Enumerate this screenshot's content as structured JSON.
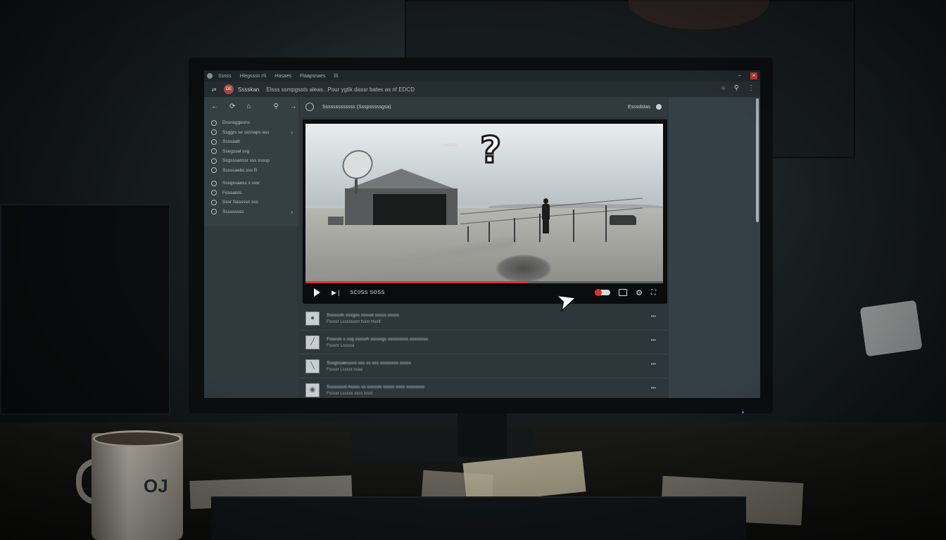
{
  "titlebar": {
    "menus": [
      "Sssss",
      "Hlegsssn rS",
      "Hasaes",
      "Flaapsnaes",
      "lS"
    ]
  },
  "addressbar": {
    "site_badge": "DE",
    "site_name": "Sssskan",
    "page_title": "Elsss ssmpgssts aleas...Pour ygtik dassr bates as nf EDCD"
  },
  "sidebar": {
    "items": [
      {
        "label": "Dssnsggesns"
      },
      {
        "label": "Ssggrs se sssnaps ass"
      },
      {
        "label": "Ssssaab"
      },
      {
        "label": "Ssegssel ssg"
      },
      {
        "label": "Ssgsssanssr sss ssssp"
      },
      {
        "label": "Sssssaebs sss R"
      },
      {
        "label": "Sssgssaess s sssr"
      },
      {
        "label": "Fossalsts"
      },
      {
        "label": "Sssr Sassssn sss"
      },
      {
        "label": "Sssssssss"
      }
    ]
  },
  "main_header": {
    "title": "Sssssssssssss (Ssspsssssgsa)",
    "right_label": "Esssdstas"
  },
  "player": {
    "overlay_symbol": "?",
    "overlay_tag": "ssslsss",
    "time": "SC0SS  SOSS",
    "progress_fraction": 0.62
  },
  "results": [
    {
      "title": "Ssssssls sssgss ssssst sssss sssss",
      "subtitle": "Fssssr Lsssssssn fsssr Hsstt",
      "more": "•••"
    },
    {
      "title": "Fssssls s ssg sssssh sssssgs sssssssss ssssssss",
      "subtitle": "Fsssnr Lsssssl",
      "more": "•••"
    },
    {
      "title": "Sssgssaessssl sss ss sss ssssssss sssss",
      "subtitle": "Fssssr Lssssr ssaa",
      "more": "•••"
    },
    {
      "title": "Ssssssssl Assss ss sssssls sssss ssss ssssssss",
      "subtitle": "Fssssr Lsssss ssss lssst",
      "more": "•••"
    }
  ],
  "mug": {
    "logo": "OJ"
  }
}
